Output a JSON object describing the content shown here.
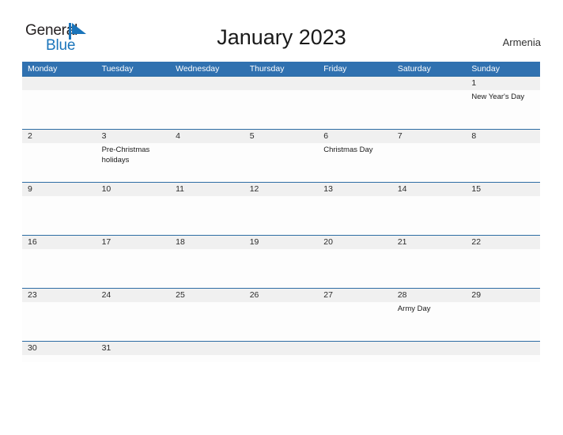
{
  "brand": {
    "name_part1": "General",
    "name_part2": "Blue",
    "icon": "flag-triangle-icon",
    "color_dark": "#231f20",
    "color_blue": "#1b75bb"
  },
  "header": {
    "title": "January 2023",
    "country": "Armenia"
  },
  "theme": {
    "header_blue": "#3071b0",
    "rule_blue": "#2e6da4",
    "band_gray": "#f0f0f0"
  },
  "calendar": {
    "weekdays": [
      "Monday",
      "Tuesday",
      "Wednesday",
      "Thursday",
      "Friday",
      "Saturday",
      "Sunday"
    ],
    "weeks": [
      {
        "days": [
          {
            "num": "",
            "events": []
          },
          {
            "num": "",
            "events": []
          },
          {
            "num": "",
            "events": []
          },
          {
            "num": "",
            "events": []
          },
          {
            "num": "",
            "events": []
          },
          {
            "num": "",
            "events": []
          },
          {
            "num": "1",
            "events": [
              "New Year's Day"
            ]
          }
        ]
      },
      {
        "days": [
          {
            "num": "2",
            "events": []
          },
          {
            "num": "3",
            "events": [
              "Pre-Christmas holidays"
            ]
          },
          {
            "num": "4",
            "events": []
          },
          {
            "num": "5",
            "events": []
          },
          {
            "num": "6",
            "events": [
              "Christmas Day"
            ]
          },
          {
            "num": "7",
            "events": []
          },
          {
            "num": "8",
            "events": []
          }
        ]
      },
      {
        "days": [
          {
            "num": "9",
            "events": []
          },
          {
            "num": "10",
            "events": []
          },
          {
            "num": "11",
            "events": []
          },
          {
            "num": "12",
            "events": []
          },
          {
            "num": "13",
            "events": []
          },
          {
            "num": "14",
            "events": []
          },
          {
            "num": "15",
            "events": []
          }
        ]
      },
      {
        "days": [
          {
            "num": "16",
            "events": []
          },
          {
            "num": "17",
            "events": []
          },
          {
            "num": "18",
            "events": []
          },
          {
            "num": "19",
            "events": []
          },
          {
            "num": "20",
            "events": []
          },
          {
            "num": "21",
            "events": []
          },
          {
            "num": "22",
            "events": []
          }
        ]
      },
      {
        "days": [
          {
            "num": "23",
            "events": []
          },
          {
            "num": "24",
            "events": []
          },
          {
            "num": "25",
            "events": []
          },
          {
            "num": "26",
            "events": []
          },
          {
            "num": "27",
            "events": []
          },
          {
            "num": "28",
            "events": [
              "Army Day"
            ]
          },
          {
            "num": "29",
            "events": []
          }
        ]
      },
      {
        "days": [
          {
            "num": "30",
            "events": []
          },
          {
            "num": "31",
            "events": []
          },
          {
            "num": "",
            "events": []
          },
          {
            "num": "",
            "events": []
          },
          {
            "num": "",
            "events": []
          },
          {
            "num": "",
            "events": []
          },
          {
            "num": "",
            "events": []
          }
        ]
      }
    ]
  }
}
